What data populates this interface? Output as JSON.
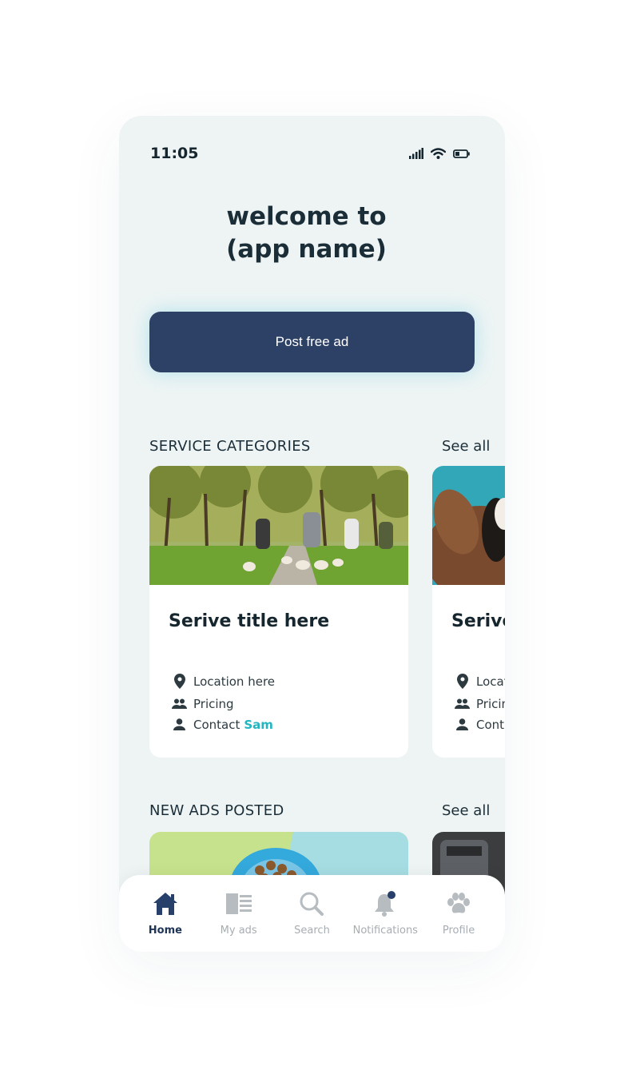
{
  "status": {
    "time": "11:05"
  },
  "welcome": {
    "line1": "welcome to",
    "line2": "(app name)"
  },
  "post_button": {
    "label": "Post free ad"
  },
  "service_categories": {
    "title": "SERVICE CATEGORIES",
    "see_all": "See all",
    "cards": [
      {
        "title": "Serive title here",
        "location": "Location here",
        "pricing": "Pricing",
        "contact_prefix": "Contact",
        "contact_name": "Sam"
      },
      {
        "title": "Serive",
        "location": "Locat",
        "pricing": "Pricin",
        "contact_prefix": "Cont",
        "contact_name": ""
      }
    ]
  },
  "new_ads": {
    "title": "NEW ADS POSTED",
    "see_all": "See all"
  },
  "nav": {
    "items": [
      {
        "label": "Home",
        "icon": "home-icon"
      },
      {
        "label": "My ads",
        "icon": "newspaper-icon"
      },
      {
        "label": "Search",
        "icon": "search-icon"
      },
      {
        "label": "Notifications",
        "icon": "bell-icon"
      },
      {
        "label": "Profile",
        "icon": "paw-icon"
      }
    ]
  },
  "colors": {
    "accent": "#2d4065",
    "link": "#21b6c0",
    "background": "#eef4f4"
  }
}
